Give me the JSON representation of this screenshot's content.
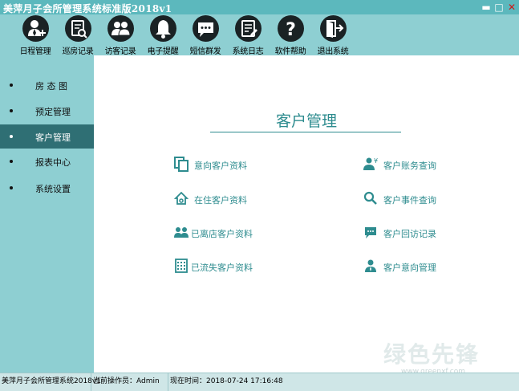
{
  "window": {
    "title": "美萍月子会所管理系统标准版2018v1",
    "controls": [
      "minimize-icon",
      "maximize-icon",
      "close-icon"
    ]
  },
  "toolbar": {
    "items": [
      {
        "label": "日程管理",
        "icon": "user-add-icon"
      },
      {
        "label": "巡房记录",
        "icon": "document-search-icon"
      },
      {
        "label": "访客记录",
        "icon": "visitors-icon"
      },
      {
        "label": "电子提醒",
        "icon": "bell-icon"
      },
      {
        "label": "短信群发",
        "icon": "message-icon"
      },
      {
        "label": "系统日志",
        "icon": "notepad-icon"
      },
      {
        "label": "软件帮助",
        "icon": "question-icon"
      },
      {
        "label": "退出系统",
        "icon": "exit-icon"
      }
    ]
  },
  "sidebar": {
    "items": [
      {
        "label": "房 态 图",
        "active": false
      },
      {
        "label": "预定管理",
        "active": false
      },
      {
        "label": "客户管理",
        "active": true
      },
      {
        "label": "报表中心",
        "active": false
      },
      {
        "label": "系统设置",
        "active": false
      }
    ]
  },
  "main": {
    "heading": "客户管理",
    "left_entries": [
      {
        "label": "意向客户资料",
        "icon": "copy-icon"
      },
      {
        "label": "在住客户资料",
        "icon": "home-icon"
      },
      {
        "label": "已离店客户资料",
        "icon": "group-icon"
      },
      {
        "label": "已流失客户资料",
        "icon": "calendar-grid-icon"
      }
    ],
    "right_entries": [
      {
        "label": "客户账务查询",
        "icon": "user-yen-icon"
      },
      {
        "label": "客户事件查询",
        "icon": "search-icon"
      },
      {
        "label": "客户回访记录",
        "icon": "chat-icon"
      },
      {
        "label": "客户意向管理",
        "icon": "business-user-icon"
      }
    ]
  },
  "statusbar": {
    "app_name": "美萍月子会所管理系统2018v1",
    "operator": "当前操作员：Admin",
    "time": "现在时间：2018-07-24 17:16:48"
  },
  "watermark": {
    "text": "绿色先锋",
    "url": "www.greenxf.com"
  },
  "colors": {
    "teal_bg": "#8ecfd2",
    "title_bar": "#5cb8bd",
    "active_nav": "#2f6f74",
    "accent_text": "#2e8c8f",
    "icon_dark": "#1a2224"
  }
}
